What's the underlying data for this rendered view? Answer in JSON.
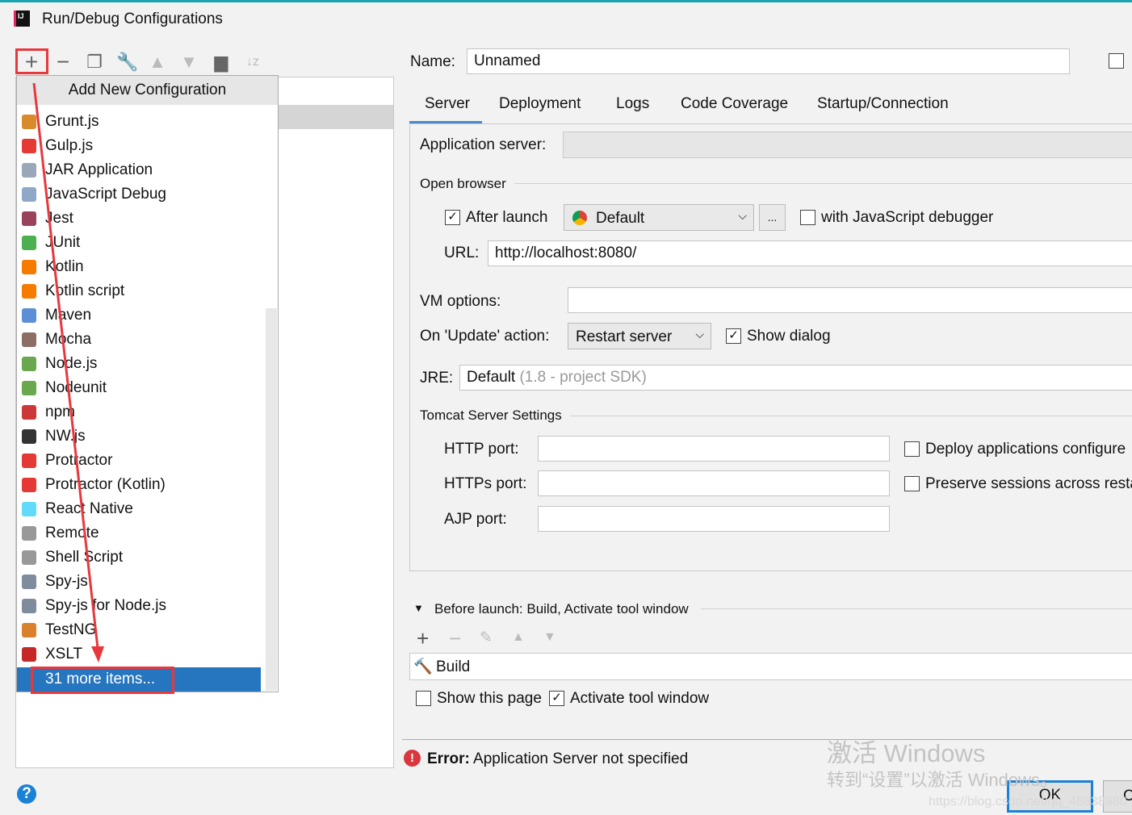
{
  "window": {
    "title": "Run/Debug Configurations",
    "logo": "IJ"
  },
  "toolbar": {
    "icons": [
      "plus-icon",
      "minus-icon",
      "copy-icon",
      "wrench-icon",
      "arrow-up-icon",
      "arrow-down-icon",
      "folder-add-icon",
      "sort-az-icon"
    ]
  },
  "popup": {
    "header": "Add New Configuration",
    "items": [
      {
        "label": "Grunt.js",
        "color": "#d98a2b"
      },
      {
        "label": "Gulp.js",
        "color": "#e53935"
      },
      {
        "label": "JAR Application",
        "color": "#9aa7b8"
      },
      {
        "label": "JavaScript Debug",
        "color": "#8fa8c8"
      },
      {
        "label": "Jest",
        "color": "#99425b"
      },
      {
        "label": "JUnit",
        "color": "#4caf50"
      },
      {
        "label": "Kotlin",
        "color": "#f57c00"
      },
      {
        "label": "Kotlin script",
        "color": "#f57c00"
      },
      {
        "label": "Maven",
        "color": "#5c8fd6"
      },
      {
        "label": "Mocha",
        "color": "#8d6e63"
      },
      {
        "label": "Node.js",
        "color": "#6aa84f"
      },
      {
        "label": "Nodeunit",
        "color": "#6aa84f"
      },
      {
        "label": "npm",
        "color": "#cb3837"
      },
      {
        "label": "NW.js",
        "color": "#333"
      },
      {
        "label": "Protractor",
        "color": "#e53935"
      },
      {
        "label": "Protractor (Kotlin)",
        "color": "#e53935"
      },
      {
        "label": "React Native",
        "color": "#61dafb"
      },
      {
        "label": "Remote",
        "color": "#999"
      },
      {
        "label": "Shell Script",
        "color": "#999"
      },
      {
        "label": "Spy-js",
        "color": "#7e8c9e"
      },
      {
        "label": "Spy-js for Node.js",
        "color": "#7e8c9e"
      },
      {
        "label": "TestNG",
        "color": "#d9822b"
      },
      {
        "label": "XSLT",
        "color": "#c62828"
      }
    ],
    "more": "31 more items..."
  },
  "name": {
    "label": "Name:",
    "value": "Unnamed"
  },
  "tabs": [
    "Server",
    "Deployment",
    "Logs",
    "Code Coverage",
    "Startup/Connection"
  ],
  "server": {
    "app_server_label": "Application server:",
    "open_browser": "Open browser",
    "after_launch": "After launch",
    "browser": "Default",
    "more_btn": "...",
    "js_debugger": "with JavaScript debugger",
    "url_label": "URL:",
    "url": "http://localhost:8080/",
    "vm_label": "VM options:",
    "update_label": "On 'Update' action:",
    "update_value": "Restart server",
    "show_dialog": "Show dialog",
    "jre_label": "JRE:",
    "jre_value": "Default",
    "jre_hint": "(1.8 - project SDK)",
    "tomcat": "Tomcat Server Settings",
    "http": "HTTP port:",
    "https": "HTTPs port:",
    "ajp": "AJP port:",
    "deploy": "Deploy applications configure",
    "preserve": "Preserve sessions across restar"
  },
  "before_launch": {
    "title": "Before launch: Build, Activate tool window",
    "item": "Build",
    "show_page": "Show this page",
    "activate": "Activate tool window"
  },
  "error": {
    "bold": "Error:",
    "text": "Application Server not specified"
  },
  "buttons": {
    "ok": "OK",
    "cancel": "C"
  },
  "watermark": {
    "line1": "激活 Windows",
    "line2": "转到“设置”以激活 Windows。",
    "url": "https://blog.csdn.net/qq_48838980"
  },
  "colors": {
    "selection": "#2675bf",
    "annotation": "#e8383d",
    "accent": "#1a82d6"
  }
}
